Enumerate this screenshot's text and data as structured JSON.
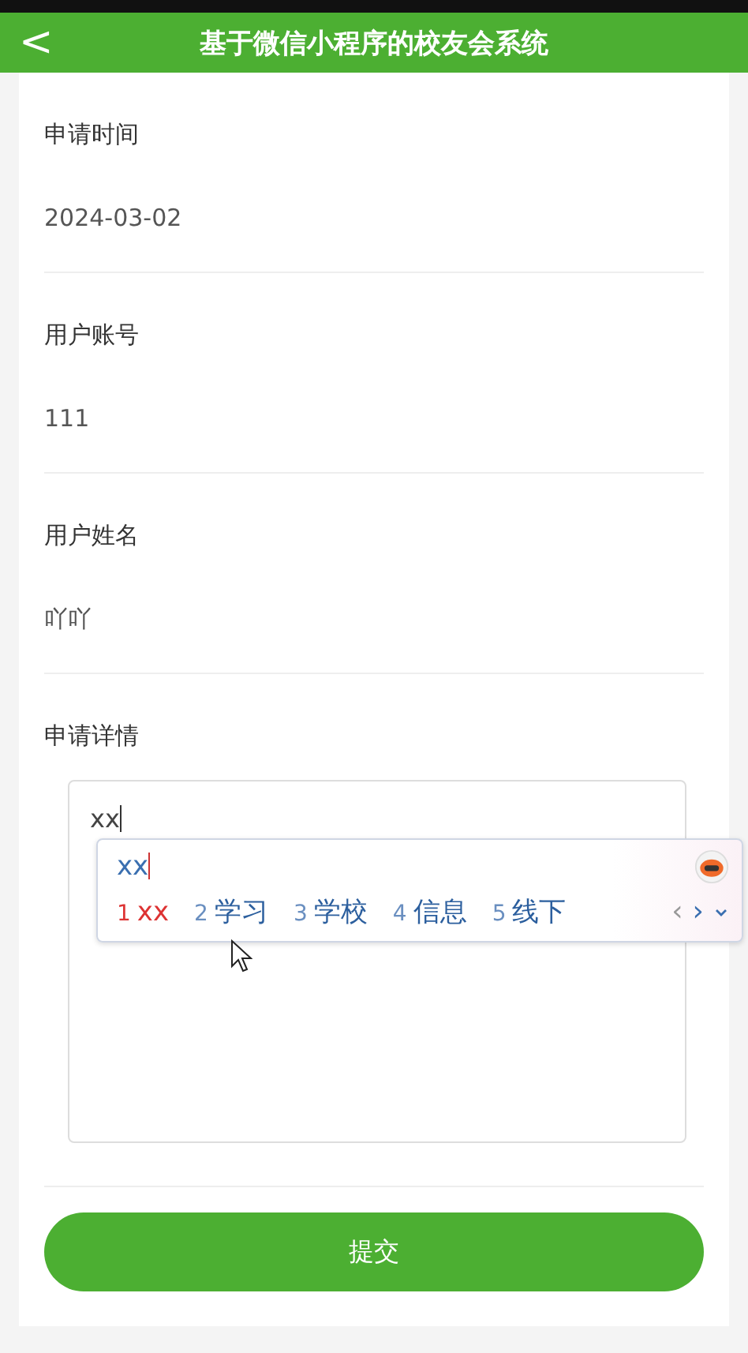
{
  "header": {
    "back": "<",
    "title": "基于微信小程序的校友会系统"
  },
  "fields": [
    {
      "label": "申请时间",
      "value": "2024-03-02"
    },
    {
      "label": "用户账号",
      "value": "111"
    },
    {
      "label": "用户姓名",
      "value": "吖吖"
    }
  ],
  "details": {
    "label": "申请详情",
    "value": "xx"
  },
  "ime": {
    "composition": "xx",
    "candidates": [
      {
        "index": "1",
        "text": "xx",
        "selected": true
      },
      {
        "index": "2",
        "text": "学习",
        "selected": false
      },
      {
        "index": "3",
        "text": "学校",
        "selected": false
      },
      {
        "index": "4",
        "text": "信息",
        "selected": false
      },
      {
        "index": "5",
        "text": "线下",
        "selected": false
      }
    ],
    "prev": "‹",
    "next": "›"
  },
  "submit": "提交"
}
